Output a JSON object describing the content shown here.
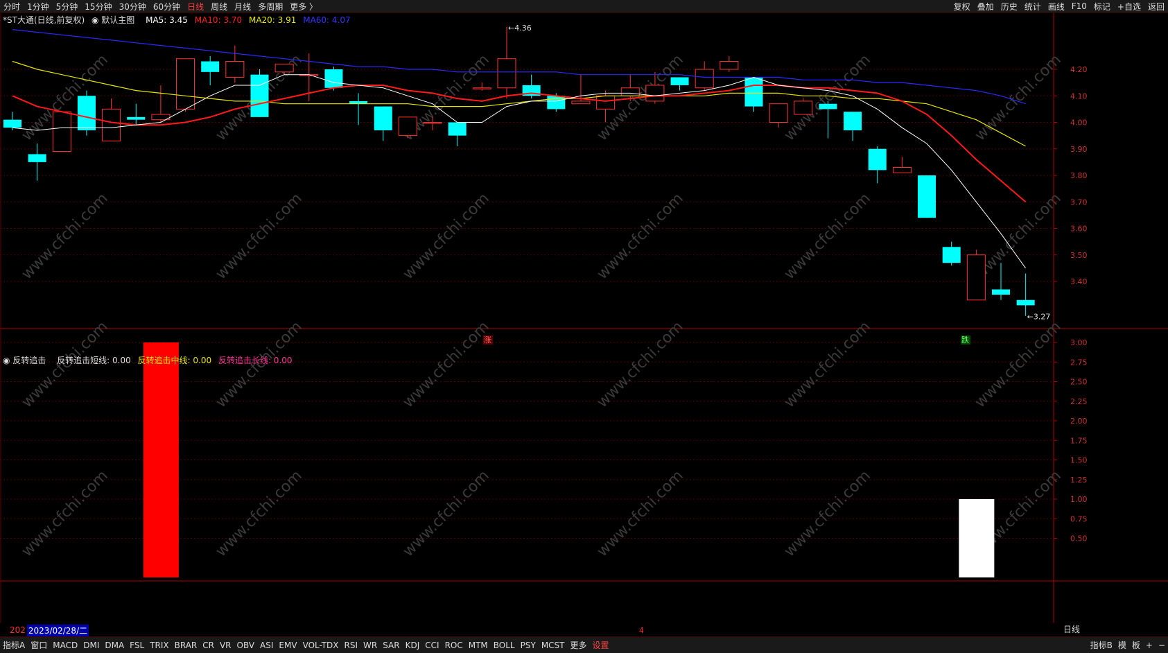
{
  "toolbar": {
    "left": [
      "分时",
      "1分钟",
      "5分钟",
      "15分钟",
      "30分钟",
      "60分钟",
      "日线",
      "周线",
      "月线",
      "多周期",
      "更多 〉"
    ],
    "active": "日线",
    "right": [
      "复权",
      "叠加",
      "历史",
      "统计",
      "画线",
      "F10",
      "标记",
      "+自选",
      "返回"
    ]
  },
  "main_legend": {
    "name": "*ST大通(日线,前复权)",
    "template": "默认主图",
    "ma5": "MA5: 3.45",
    "ma10": "MA10: 3.70",
    "ma20": "MA20: 3.91",
    "ma60": "MA60: 4.07"
  },
  "sub_legend": {
    "name": "反转追击",
    "short": "反转追击短线: 0.00",
    "mid": "反转追击中线: 0.00",
    "long": "反转追击长线: 0.00"
  },
  "annotations": {
    "high_label": "4.36",
    "low_label": "3.27",
    "up_marker": "涨",
    "down_marker": "跌"
  },
  "axis": {
    "main_ticks": [
      "4.20",
      "4.10",
      "4.00",
      "3.90",
      "3.80",
      "3.70",
      "3.60",
      "3.50",
      "3.40"
    ],
    "sub_ticks": [
      "3.00",
      "2.75",
      "2.50",
      "2.25",
      "2.00",
      "1.75",
      "1.50",
      "1.25",
      "1.00",
      "0.75",
      "0.50"
    ],
    "period_label": "日线"
  },
  "date_bar": {
    "prefix": "202",
    "cursor_date": "2023/02/28/二",
    "month_mark": "4"
  },
  "bottom_tabs": [
    "指标A",
    "窗口",
    "MACD",
    "DMI",
    "DMA",
    "FSL",
    "TRIX",
    "BRAR",
    "CR",
    "VR",
    "OBV",
    "ASI",
    "EMV",
    "VOL-TDX",
    "RSI",
    "WR",
    "SAR",
    "KDJ",
    "CCI",
    "ROC",
    "MTM",
    "BOLL",
    "PSY",
    "MCST",
    "更多",
    "设置"
  ],
  "bottom_right": [
    "指标B",
    "模",
    "板",
    "+",
    "−"
  ],
  "watermark": "www.cfchi.com",
  "colors": {
    "up": "#ff3232",
    "down": "#00ffff",
    "ma5": "#ffffff",
    "ma10": "#ff1a1a",
    "ma20": "#e6e600",
    "ma60": "#2a2aff",
    "grid": "#550000"
  },
  "chart_data": {
    "type": "candlestick",
    "price_axis": [
      3.27,
      4.36
    ],
    "candles": [
      {
        "o": 4.01,
        "h": 4.04,
        "l": 3.97,
        "c": 3.98
      },
      {
        "o": 3.88,
        "h": 3.92,
        "l": 3.78,
        "c": 3.85
      },
      {
        "o": 3.89,
        "h": 4.04,
        "l": 3.89,
        "c": 4.04
      },
      {
        "o": 4.1,
        "h": 4.12,
        "l": 3.95,
        "c": 3.97
      },
      {
        "o": 3.93,
        "h": 4.09,
        "l": 3.93,
        "c": 4.05
      },
      {
        "o": 4.02,
        "h": 4.07,
        "l": 3.99,
        "c": 4.01
      },
      {
        "o": 4.01,
        "h": 4.14,
        "l": 4.0,
        "c": 4.03
      },
      {
        "o": 4.05,
        "h": 4.24,
        "l": 4.04,
        "c": 4.24
      },
      {
        "o": 4.23,
        "h": 4.25,
        "l": 4.14,
        "c": 4.19
      },
      {
        "o": 4.17,
        "h": 4.29,
        "l": 4.15,
        "c": 4.23
      },
      {
        "o": 4.18,
        "h": 4.2,
        "l": 4.02,
        "c": 4.02
      },
      {
        "o": 4.19,
        "h": 4.22,
        "l": 4.18,
        "c": 4.22
      },
      {
        "o": 4.18,
        "h": 4.26,
        "l": 4.08,
        "c": 4.18
      },
      {
        "o": 4.2,
        "h": 4.21,
        "l": 4.12,
        "c": 4.13
      },
      {
        "o": 4.08,
        "h": 4.11,
        "l": 3.99,
        "c": 4.07
      },
      {
        "o": 4.06,
        "h": 4.06,
        "l": 3.93,
        "c": 3.97
      },
      {
        "o": 3.95,
        "h": 4.02,
        "l": 3.94,
        "c": 4.02
      },
      {
        "o": 4.0,
        "h": 4.02,
        "l": 3.97,
        "c": 4.0
      },
      {
        "o": 4.0,
        "h": 4.0,
        "l": 3.91,
        "c": 3.95
      },
      {
        "o": 4.13,
        "h": 4.15,
        "l": 4.12,
        "c": 4.13
      },
      {
        "o": 4.13,
        "h": 4.36,
        "l": 4.09,
        "c": 4.24
      },
      {
        "o": 4.14,
        "h": 4.18,
        "l": 4.09,
        "c": 4.1
      },
      {
        "o": 4.1,
        "h": 4.11,
        "l": 4.04,
        "c": 4.05
      },
      {
        "o": 4.07,
        "h": 4.18,
        "l": 4.07,
        "c": 4.08
      },
      {
        "o": 4.05,
        "h": 4.12,
        "l": 4.0,
        "c": 4.1
      },
      {
        "o": 4.1,
        "h": 4.18,
        "l": 4.08,
        "c": 4.13
      },
      {
        "o": 4.08,
        "h": 4.19,
        "l": 4.07,
        "c": 4.14
      },
      {
        "o": 4.17,
        "h": 4.17,
        "l": 4.12,
        "c": 4.14
      },
      {
        "o": 4.13,
        "h": 4.23,
        "l": 4.12,
        "c": 4.2
      },
      {
        "o": 4.2,
        "h": 4.25,
        "l": 4.19,
        "c": 4.23
      },
      {
        "o": 4.17,
        "h": 4.17,
        "l": 4.04,
        "c": 4.06
      },
      {
        "o": 4.0,
        "h": 4.06,
        "l": 3.98,
        "c": 4.07
      },
      {
        "o": 4.03,
        "h": 4.09,
        "l": 4.03,
        "c": 4.08
      },
      {
        "o": 4.07,
        "h": 4.08,
        "l": 3.94,
        "c": 4.05
      },
      {
        "o": 4.04,
        "h": 4.04,
        "l": 3.93,
        "c": 3.97
      },
      {
        "o": 3.9,
        "h": 3.91,
        "l": 3.77,
        "c": 3.82
      },
      {
        "o": 3.81,
        "h": 3.87,
        "l": 3.81,
        "c": 3.83
      },
      {
        "o": 3.8,
        "h": 3.8,
        "l": 3.64,
        "c": 3.64
      },
      {
        "o": 3.53,
        "h": 3.55,
        "l": 3.46,
        "c": 3.47
      },
      {
        "o": 3.33,
        "h": 3.52,
        "l": 3.33,
        "c": 3.5
      },
      {
        "o": 3.37,
        "h": 3.47,
        "l": 3.33,
        "c": 3.35
      },
      {
        "o": 3.33,
        "h": 3.43,
        "l": 3.27,
        "c": 3.31
      }
    ],
    "ma5": [
      3.98,
      3.97,
      3.98,
      3.98,
      3.98,
      3.99,
      4.0,
      4.05,
      4.1,
      4.14,
      4.14,
      4.18,
      4.18,
      4.15,
      4.14,
      4.13,
      4.1,
      4.07,
      4.0,
      4.0,
      4.06,
      4.08,
      4.08,
      4.1,
      4.11,
      4.11,
      4.1,
      4.11,
      4.12,
      4.14,
      4.17,
      4.14,
      4.13,
      4.12,
      4.1,
      4.05,
      3.98,
      3.92,
      3.82,
      3.7,
      3.58,
      3.45
    ],
    "ma10": [
      4.1,
      4.06,
      4.04,
      4.02,
      4.0,
      3.99,
      3.99,
      4.0,
      4.02,
      4.05,
      4.07,
      4.09,
      4.11,
      4.13,
      4.14,
      4.14,
      4.12,
      4.11,
      4.09,
      4.08,
      4.1,
      4.11,
      4.1,
      4.09,
      4.08,
      4.09,
      4.1,
      4.1,
      4.11,
      4.12,
      4.14,
      4.14,
      4.13,
      4.13,
      4.12,
      4.11,
      4.08,
      4.03,
      3.95,
      3.86,
      3.78,
      3.7
    ],
    "ma20": [
      4.23,
      4.2,
      4.18,
      4.16,
      4.14,
      4.12,
      4.11,
      4.1,
      4.09,
      4.08,
      4.08,
      4.07,
      4.07,
      4.07,
      4.07,
      4.07,
      4.07,
      4.06,
      4.06,
      4.06,
      4.07,
      4.08,
      4.09,
      4.09,
      4.1,
      4.1,
      4.1,
      4.1,
      4.1,
      4.11,
      4.11,
      4.11,
      4.1,
      4.1,
      4.09,
      4.09,
      4.08,
      4.07,
      4.04,
      4.01,
      3.96,
      3.91
    ],
    "ma60": [
      4.35,
      4.34,
      4.33,
      4.32,
      4.31,
      4.3,
      4.29,
      4.28,
      4.27,
      4.26,
      4.25,
      4.24,
      4.23,
      4.22,
      4.21,
      4.21,
      4.2,
      4.2,
      4.19,
      4.19,
      4.19,
      4.19,
      4.19,
      4.18,
      4.18,
      4.18,
      4.18,
      4.18,
      4.17,
      4.17,
      4.17,
      4.17,
      4.16,
      4.16,
      4.16,
      4.15,
      4.15,
      4.14,
      4.13,
      4.12,
      4.1,
      4.07
    ],
    "indicator": {
      "ylim": [
        0,
        3
      ],
      "bars": [
        {
          "index": 6,
          "value": 3.0,
          "color": "red"
        },
        {
          "index": 39,
          "value": 1.0,
          "color": "white"
        }
      ]
    }
  }
}
